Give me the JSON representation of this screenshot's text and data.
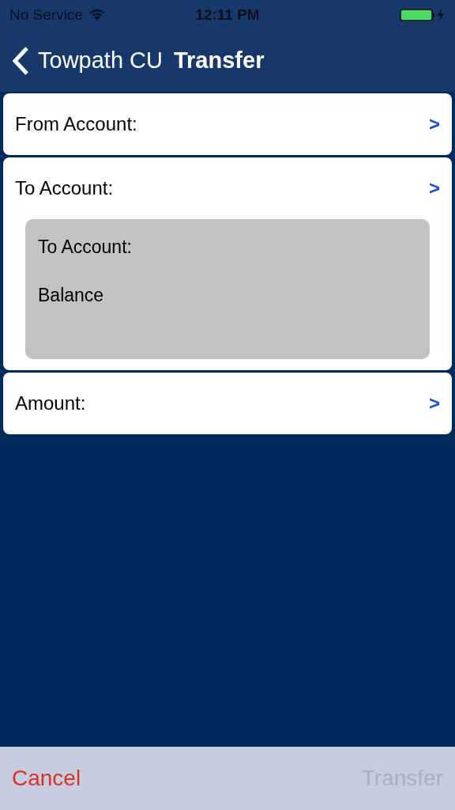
{
  "status_bar": {
    "carrier": "No Service",
    "time": "12:11 PM"
  },
  "nav": {
    "back_label": "Towpath CU",
    "title": "Transfer"
  },
  "rows": [
    {
      "kind": "row",
      "label": "From Account:",
      "chevron": ">"
    },
    {
      "kind": "detail",
      "label": "To Account:",
      "chevron": ">",
      "detail_lines": [
        "To Account:",
        "Balance"
      ]
    },
    {
      "kind": "row",
      "label": "Amount:",
      "chevron": ">"
    }
  ],
  "toolbar": {
    "cancel": "Cancel",
    "submit": {
      "label": "Transfer",
      "disabled": true
    }
  }
}
